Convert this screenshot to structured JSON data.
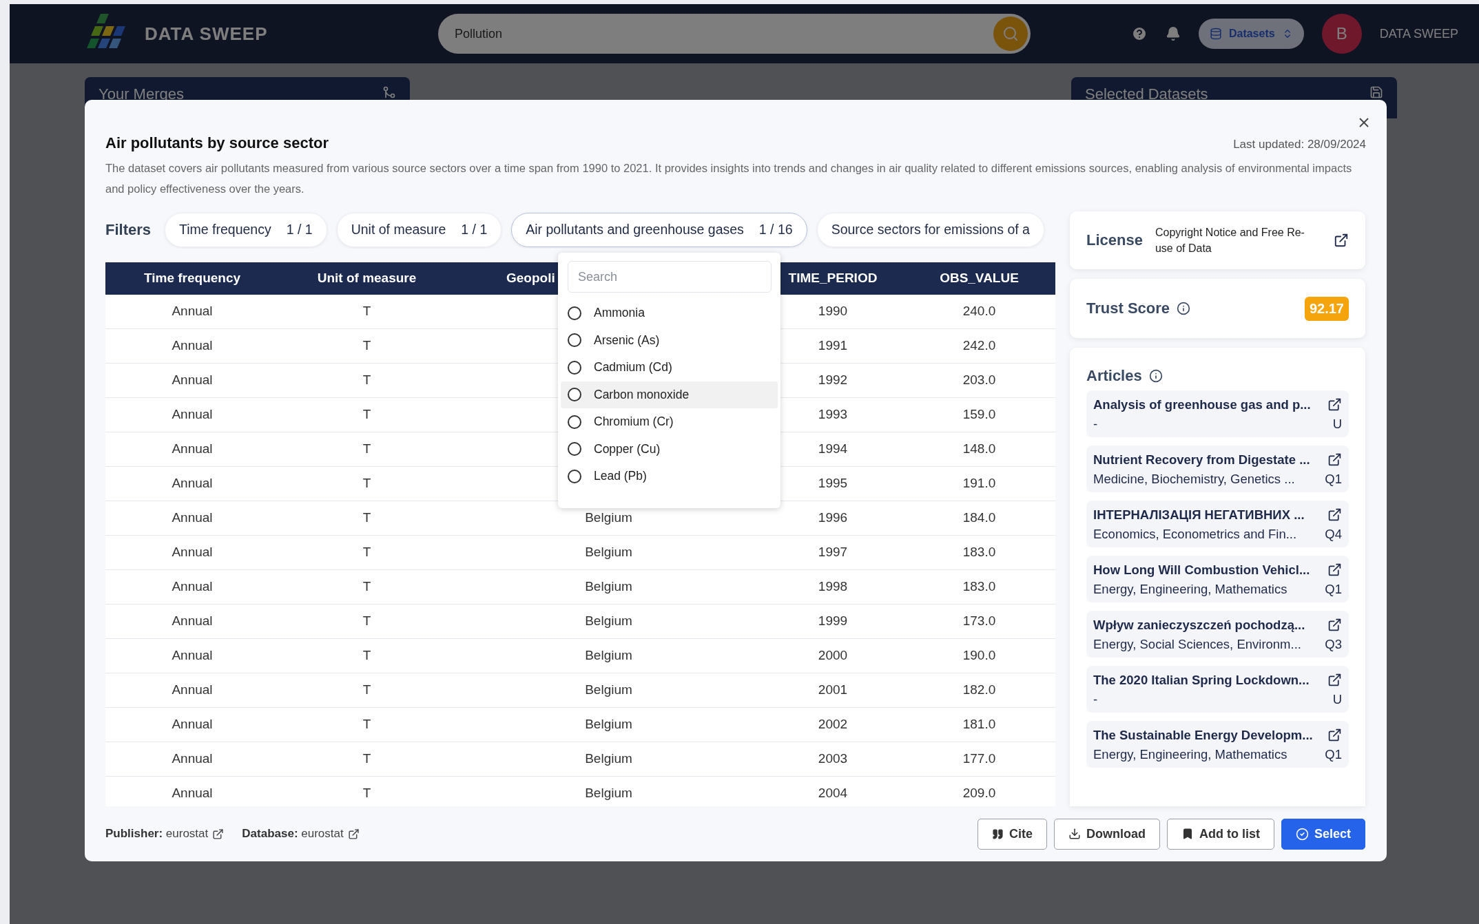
{
  "header": {
    "brand": "DATA SWEEP",
    "search": {
      "value": "Pollution"
    },
    "datasets_button": "Datasets",
    "avatar": "B",
    "user": "DATA SWEEP"
  },
  "background_cards": [
    {
      "title": "Your Merges"
    },
    {
      "title": "Selected Datasets"
    }
  ],
  "dialog": {
    "title": "Air pollutants by source sector",
    "last_updated": "Last updated: 28/09/2024",
    "description": "The dataset covers air pollutants measured from various source sectors over a time span from 1990 to 2021. It provides insights into trends and changes in air quality related to different emissions sources, enabling analysis of environmental impacts and policy effectiveness over the years.",
    "filters_label": "Filters",
    "filters": [
      {
        "label": "Time frequency",
        "count": "1 / 1",
        "expanded": false
      },
      {
        "label": "Unit of measure",
        "count": "1 / 1",
        "expanded": false
      },
      {
        "label": "Air pollutants and greenhouse gases",
        "count": "1 / 16",
        "expanded": true
      },
      {
        "label": "Source sectors for emissions of a",
        "expanded": false
      }
    ],
    "dropdown": {
      "placeholder": "Search",
      "options": [
        {
          "label": "Ammonia",
          "selected": false,
          "highlighted": false
        },
        {
          "label": "Arsenic (As)",
          "selected": false,
          "highlighted": false
        },
        {
          "label": "Cadmium (Cd)",
          "selected": false,
          "highlighted": false
        },
        {
          "label": "Carbon monoxide",
          "selected": false,
          "highlighted": true
        },
        {
          "label": "Chromium (Cr)",
          "selected": false,
          "highlighted": false
        },
        {
          "label": "Copper (Cu)",
          "selected": false,
          "highlighted": false
        },
        {
          "label": "Lead (Pb)",
          "selected": false,
          "highlighted": false
        }
      ]
    },
    "table": {
      "columns": [
        "Time frequency",
        "Unit of measure",
        "Geopoli",
        "TIME_PERIOD",
        "OBS_VALUE"
      ],
      "rows": [
        [
          "Annual",
          "T",
          null,
          "1990",
          "240.0"
        ],
        [
          "Annual",
          "T",
          null,
          "1991",
          "242.0"
        ],
        [
          "Annual",
          "T",
          null,
          "1992",
          "203.0"
        ],
        [
          "Annual",
          "T",
          null,
          "1993",
          "159.0"
        ],
        [
          "Annual",
          "T",
          null,
          "1994",
          "148.0"
        ],
        [
          "Annual",
          "T",
          null,
          "1995",
          "191.0"
        ],
        [
          "Annual",
          "T",
          "Belgium",
          "1996",
          "184.0"
        ],
        [
          "Annual",
          "T",
          "Belgium",
          "1997",
          "183.0"
        ],
        [
          "Annual",
          "T",
          "Belgium",
          "1998",
          "183.0"
        ],
        [
          "Annual",
          "T",
          "Belgium",
          "1999",
          "173.0"
        ],
        [
          "Annual",
          "T",
          "Belgium",
          "2000",
          "190.0"
        ],
        [
          "Annual",
          "T",
          "Belgium",
          "2001",
          "182.0"
        ],
        [
          "Annual",
          "T",
          "Belgium",
          "2002",
          "181.0"
        ],
        [
          "Annual",
          "T",
          "Belgium",
          "2003",
          "177.0"
        ],
        [
          "Annual",
          "T",
          "Belgium",
          "2004",
          "209.0"
        ]
      ]
    },
    "license": {
      "label": "License",
      "value": "Copyright Notice and Free Re-use of Data"
    },
    "trust_score": {
      "label": "Trust Score",
      "value": "92.17"
    },
    "articles": {
      "label": "Articles",
      "items": [
        {
          "title": "Analysis of greenhouse gas and p...",
          "subjects": "-",
          "quartile": "U"
        },
        {
          "title": "Nutrient Recovery from Digestate ...",
          "subjects": "Medicine, Biochemistry, Genetics ...",
          "quartile": "Q1"
        },
        {
          "title": "ІНТЕРНАЛІЗАЦІЯ НЕГАТИВНИХ ...",
          "subjects": "Economics, Econometrics and Fin...",
          "quartile": "Q4"
        },
        {
          "title": "How Long Will Combustion Vehicl...",
          "subjects": "Energy, Engineering, Mathematics",
          "quartile": "Q1"
        },
        {
          "title": "Wpływ zanieczyszczeń pochodzą...",
          "subjects": "Energy, Social Sciences, Environm...",
          "quartile": "Q3"
        },
        {
          "title": "The 2020 Italian Spring Lockdown...",
          "subjects": "-",
          "quartile": "U"
        },
        {
          "title": "The Sustainable Energy Developm...",
          "subjects": "Energy, Engineering, Mathematics",
          "quartile": "Q1"
        }
      ]
    },
    "footer": {
      "links": [
        "**Publisher:** eurostat",
        "**Database:** eurostat"
      ],
      "buttons": [
        {
          "label": "Cite",
          "kind": "cite"
        },
        {
          "label": "Download",
          "kind": "download"
        },
        {
          "label": "Add to list",
          "kind": "bookmark"
        },
        {
          "label": "Select",
          "kind": "primary"
        }
      ]
    }
  }
}
